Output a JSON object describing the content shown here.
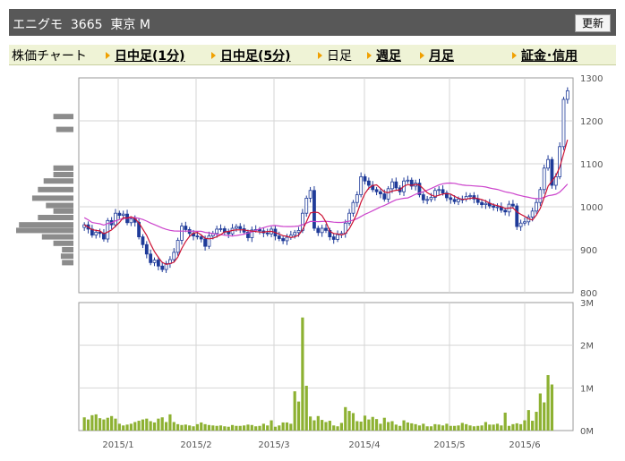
{
  "header": {
    "title": "エニグモ  3665  東京 M",
    "refresh_label": "更新"
  },
  "nav": {
    "items": [
      {
        "label": "株価チャート",
        "link": false,
        "arrow": false
      },
      {
        "label": "日中足(1分)",
        "link": true,
        "arrow": true
      },
      {
        "label": "日中足(5分)",
        "link": true,
        "arrow": true
      },
      {
        "label": "日足",
        "link": false,
        "arrow": true
      },
      {
        "label": "週足",
        "link": true,
        "arrow": true
      },
      {
        "label": "月足",
        "link": true,
        "arrow": true
      },
      {
        "label": "証金･信用",
        "link": true,
        "arrow": true
      }
    ]
  },
  "colors": {
    "up_candle": "#ffffff",
    "down_candle": "#1f3b99",
    "ma_short": "#cc1133",
    "ma_long": "#cc44cc",
    "volume": "#8db132",
    "grid": "#d4d4d4",
    "profile": "#8c8c8c"
  },
  "chart_data": [
    {
      "type": "candlestick",
      "name": "price",
      "ylim": [
        800,
        1300
      ],
      "yticks": [
        800,
        900,
        1000,
        1100,
        1200,
        1300
      ],
      "x_tick_labels": [
        "2015/1",
        "2015/2",
        "2015/3",
        "2015/4",
        "2015/5",
        "2015/6"
      ],
      "closes": [
        958,
        948,
        934,
        941,
        938,
        925,
        968,
        958,
        985,
        980,
        983,
        963,
        972,
        964,
        930,
        912,
        890,
        870,
        876,
        862,
        854,
        868,
        877,
        894,
        922,
        955,
        947,
        938,
        932,
        930,
        925,
        908,
        932,
        938,
        948,
        949,
        941,
        937,
        950,
        954,
        949,
        941,
        928,
        946,
        947,
        944,
        939,
        937,
        948,
        932,
        926,
        921,
        929,
        934,
        940,
        945,
        985,
        1020,
        1038,
        950,
        940,
        950,
        945,
        930,
        924,
        935,
        938,
        962,
        985,
        1010,
        1028,
        1070,
        1060,
        1050,
        1040,
        1035,
        1030,
        1018,
        1042,
        1058,
        1044,
        1035,
        1060,
        1062,
        1048,
        1055,
        1028,
        1016,
        1017,
        1022,
        1038,
        1040,
        1032,
        1021,
        1017,
        1012,
        1018,
        1018,
        1024,
        1026,
        1018,
        1010,
        1005,
        1008,
        1002,
        999,
        1000,
        992,
        988,
        1006,
        1002,
        954,
        962,
        965,
        976,
        990,
        1010,
        1040,
        1090,
        1110,
        1050,
        1070,
        1140,
        1250,
        1270
      ],
      "volume_labels": [
        "3M",
        "2M",
        "1M",
        "0M"
      ],
      "volume_ylim": [
        0,
        3000000
      ],
      "volumes": [
        310000,
        260000,
        360000,
        380000,
        290000,
        260000,
        300000,
        340000,
        280000,
        160000,
        120000,
        140000,
        160000,
        200000,
        230000,
        260000,
        280000,
        220000,
        190000,
        280000,
        310000,
        200000,
        380000,
        200000,
        150000,
        130000,
        140000,
        120000,
        100000,
        150000,
        190000,
        150000,
        130000,
        120000,
        110000,
        120000,
        100000,
        90000,
        130000,
        110000,
        110000,
        120000,
        140000,
        130000,
        100000,
        110000,
        160000,
        120000,
        240000,
        90000,
        120000,
        190000,
        190000,
        160000,
        920000,
        680000,
        2650000,
        1050000,
        330000,
        240000,
        340000,
        250000,
        200000,
        230000,
        120000,
        100000,
        180000,
        550000,
        460000,
        410000,
        220000,
        210000,
        350000,
        260000,
        320000,
        270000,
        160000,
        300000,
        200000,
        220000,
        140000,
        110000,
        240000,
        190000,
        170000,
        150000,
        120000,
        160000,
        100000,
        100000,
        150000,
        140000,
        120000,
        160000,
        110000,
        110000,
        120000,
        180000,
        150000,
        120000,
        100000,
        110000,
        120000,
        200000,
        140000,
        140000,
        160000,
        120000,
        420000,
        110000,
        150000,
        170000,
        150000,
        240000,
        480000,
        230000,
        440000,
        870000,
        660000,
        1300000,
        1080000
      ],
      "volume_profile": [
        {
          "price": 1210,
          "size": 0.35
        },
        {
          "price": 1180,
          "size": 0.3
        },
        {
          "price": 1090,
          "size": 0.35
        },
        {
          "price": 1075,
          "size": 0.35
        },
        {
          "price": 1060,
          "size": 0.52
        },
        {
          "price": 1040,
          "size": 0.62
        },
        {
          "price": 1020,
          "size": 0.72
        },
        {
          "price": 1003,
          "size": 0.48
        },
        {
          "price": 990,
          "size": 0.35
        },
        {
          "price": 975,
          "size": 0.62
        },
        {
          "price": 958,
          "size": 0.95
        },
        {
          "price": 945,
          "size": 1.0
        },
        {
          "price": 930,
          "size": 0.55
        },
        {
          "price": 915,
          "size": 0.35
        },
        {
          "price": 900,
          "size": 0.2
        },
        {
          "price": 885,
          "size": 0.22
        },
        {
          "price": 870,
          "size": 0.2
        }
      ]
    }
  ]
}
